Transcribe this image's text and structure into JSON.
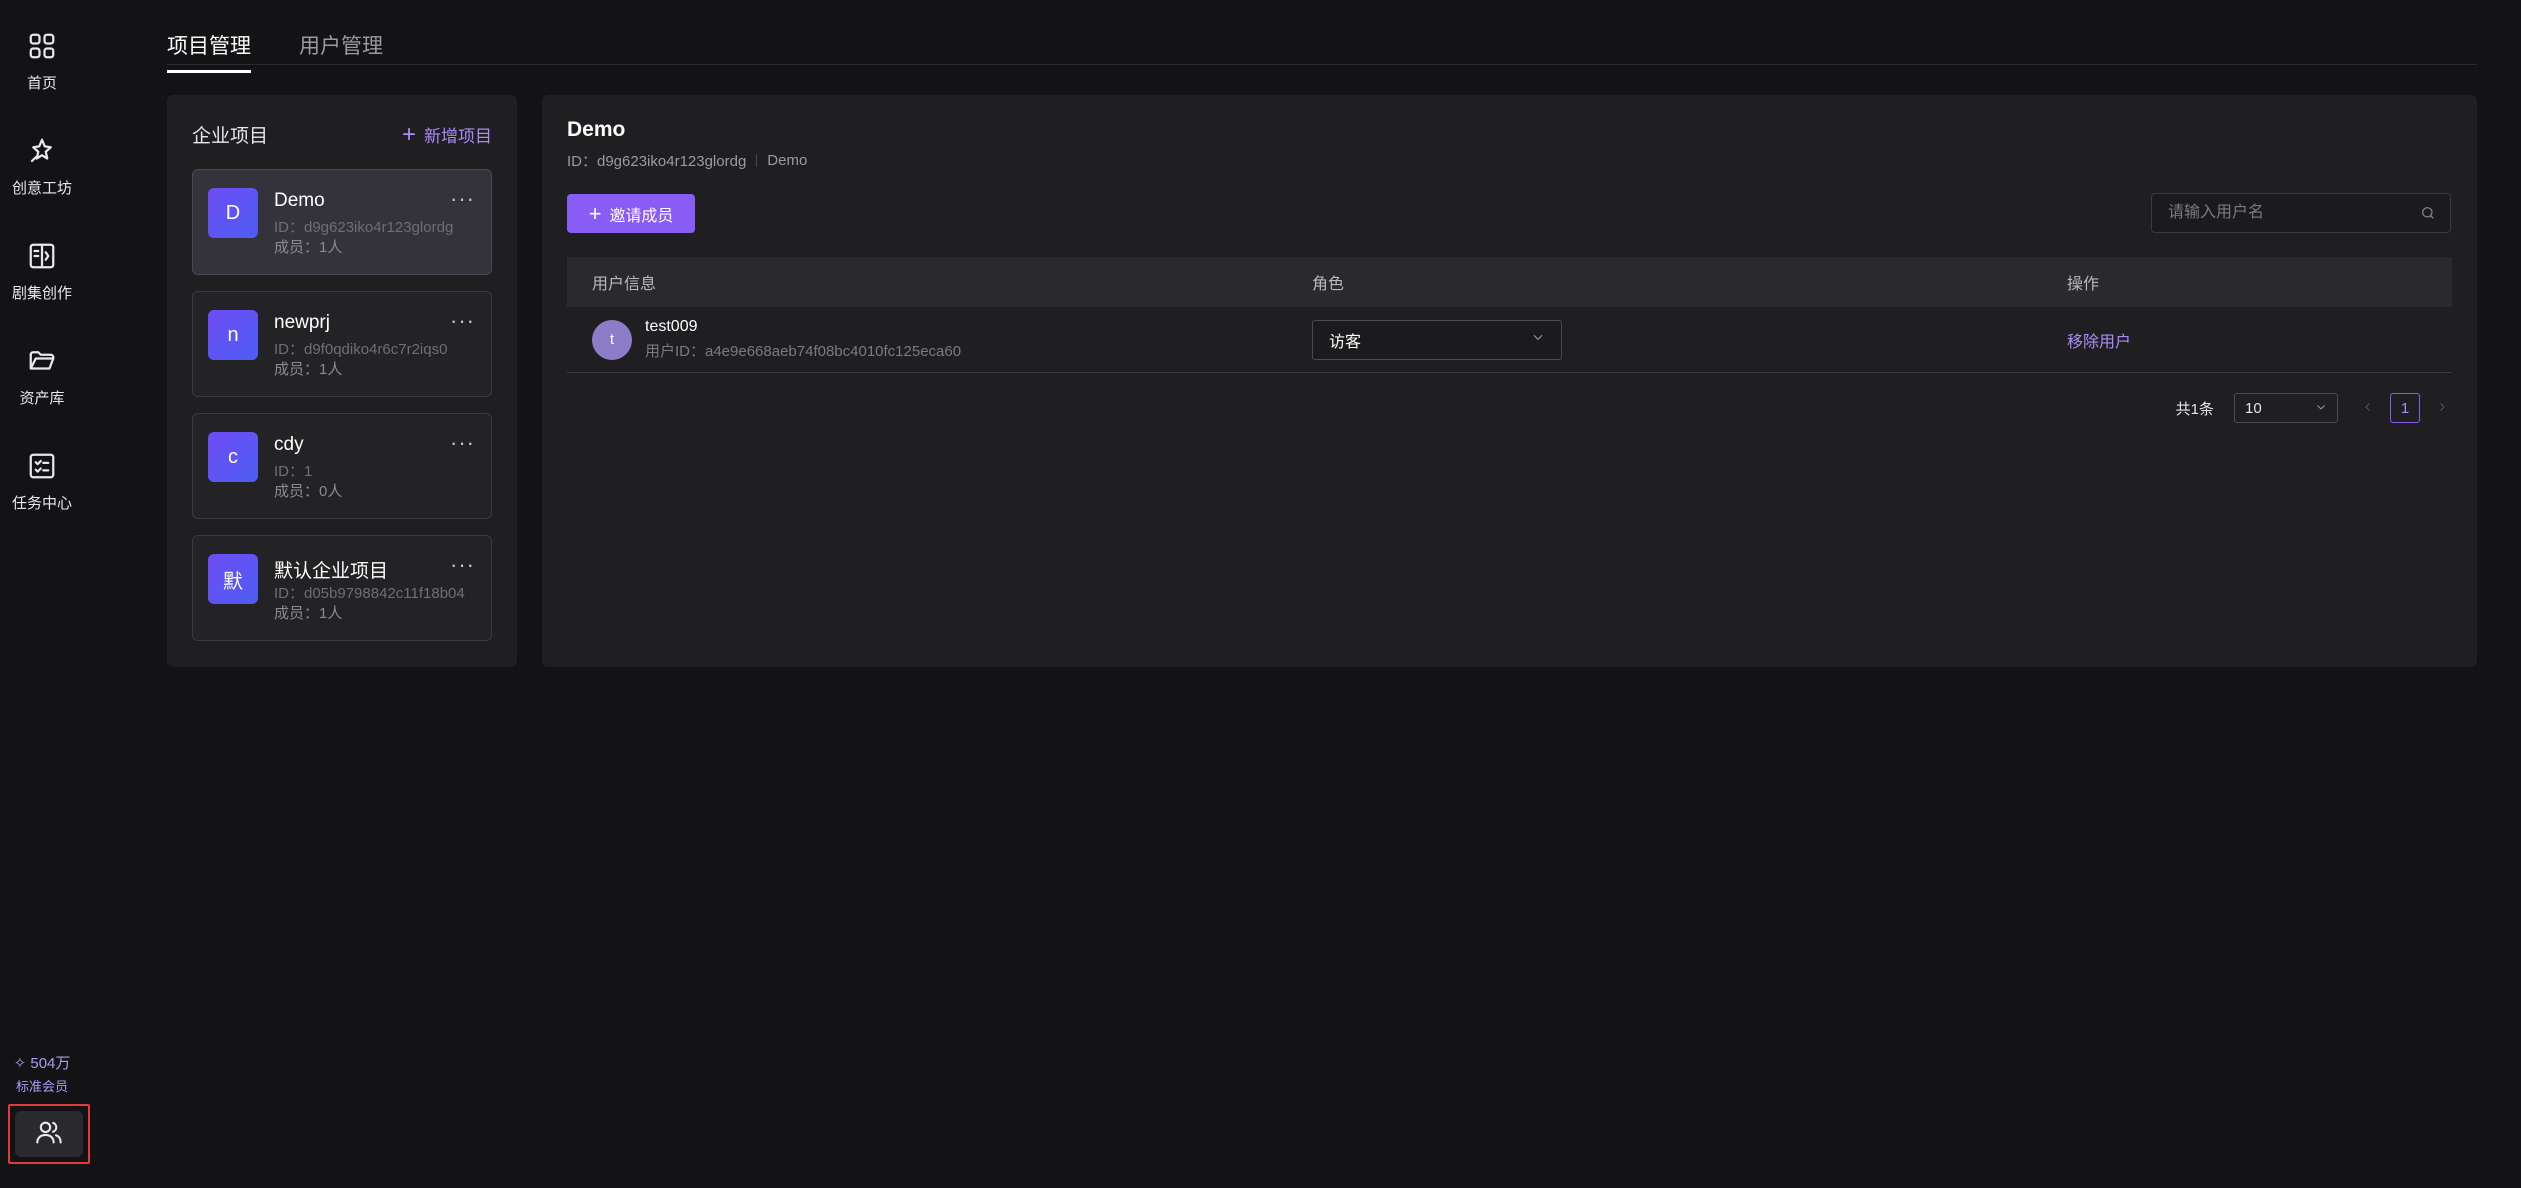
{
  "nav": {
    "items": [
      {
        "label": "首页",
        "icon": "grid-icon"
      },
      {
        "label": "创意工坊",
        "icon": "sparkle-star-icon"
      },
      {
        "label": "剧集创作",
        "icon": "book-icon"
      },
      {
        "label": "资产库",
        "icon": "folder-icon"
      },
      {
        "label": "任务中心",
        "icon": "task-list-icon"
      }
    ],
    "credits": "✧ 504万",
    "membership": "标准会员"
  },
  "tabs": [
    "项目管理",
    "用户管理"
  ],
  "projects_panel": {
    "title": "企业项目",
    "add_label": "新增项目",
    "projects": [
      {
        "initial": "D",
        "name": "Demo",
        "id": "ID：d9g623iko4r123glordg",
        "members": "成员：1人",
        "selected": true
      },
      {
        "initial": "n",
        "name": "newprj",
        "id": "ID：d9f0qdiko4r6c7r2iqs0",
        "members": "成员：1人",
        "selected": false
      },
      {
        "initial": "c",
        "name": "cdy",
        "id": "ID：1",
        "members": "成员：0人",
        "selected": false
      },
      {
        "initial": "默",
        "name": "默认企业项目",
        "id": "ID：d05b9798842c11f18b04",
        "members": "成员：1人",
        "selected": false
      }
    ]
  },
  "detail": {
    "title": "Demo",
    "id": "ID：d9g623iko4r123glordg",
    "project_name": "Demo",
    "invite_label": "邀请成员",
    "search_placeholder": "请输入用户名",
    "columns": [
      "用户信息",
      "角色",
      "操作"
    ],
    "rows": [
      {
        "avatar": "t",
        "username": "test009",
        "user_id": "用户ID：a4e9e668aeb74f08bc4010fc125eca60",
        "role": "访客",
        "action": "移除用户"
      }
    ],
    "pagination": {
      "total": "共1条",
      "page_size": "10",
      "current_page": "1"
    }
  },
  "colors": {
    "accent": "#8a5cf6",
    "link": "#a98cf8",
    "background": "#131316",
    "panel": "#1f1f22",
    "highlight_border": "#e03a3a"
  }
}
